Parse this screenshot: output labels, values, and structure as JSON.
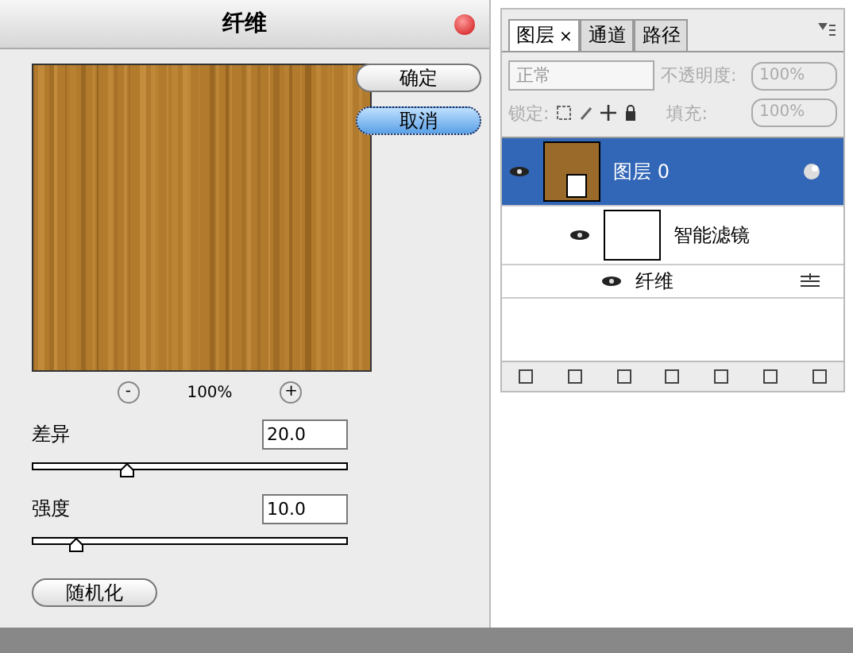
{
  "dialog": {
    "title": "纤维",
    "buttons": [
      {
        "label": "确定",
        "selected": false
      },
      {
        "label": "取消",
        "selected": true
      }
    ],
    "zoom": {
      "minus": "-",
      "value": "100%",
      "plus": "+"
    },
    "sliders": [
      {
        "label": "差异",
        "value": "20.0",
        "level": 0.3
      },
      {
        "label": "强度",
        "value": "10.0",
        "level": 0.14
      }
    ],
    "random_button": "随机化"
  },
  "layers_panel": {
    "tabs": [
      {
        "label": "图层",
        "close": "×",
        "selected": true
      },
      {
        "label": "通道",
        "selected": false
      },
      {
        "label": "路径",
        "selected": false
      }
    ],
    "blend_mode": "正常",
    "opacity_label": "不透明度:",
    "opacity": "100%",
    "lock_label": "锁定:",
    "fill_label": "填充:",
    "fill": "100%",
    "layers": [
      {
        "name": "图层 0",
        "selected": true,
        "visible": true,
        "children": [
          {
            "name": "智能滤镜",
            "visible": true,
            "children": [
              {
                "name": "纤维",
                "visible": true
              }
            ]
          }
        ]
      }
    ]
  }
}
